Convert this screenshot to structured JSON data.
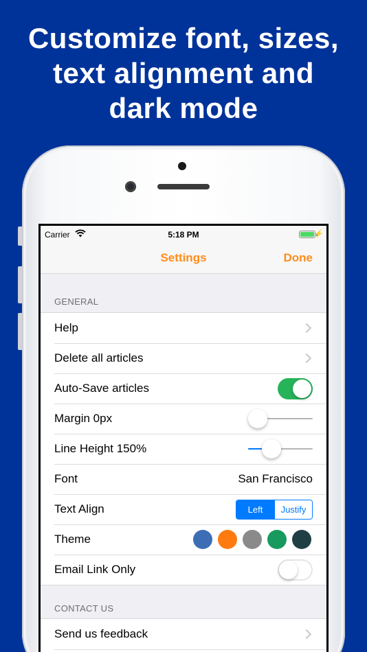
{
  "headline": {
    "line1": "Customize font, sizes,",
    "line2": "text alignment and",
    "line3": "dark mode"
  },
  "status_bar": {
    "carrier": "Carrier",
    "time": "5:18 PM",
    "battery_level": 1.0
  },
  "nav": {
    "title": "Settings",
    "done_label": "Done"
  },
  "general": {
    "header": "GENERAL",
    "help": "Help",
    "delete_all": "Delete all articles",
    "auto_save": {
      "label": "Auto-Save articles",
      "on": true
    },
    "margin": {
      "label": "Margin 0px",
      "value": 0.0
    },
    "line_height": {
      "label": "Line Height 150%",
      "value": 0.3
    },
    "font": {
      "label": "Font",
      "value": "San Francisco"
    },
    "text_align": {
      "label": "Text Align",
      "options": [
        "Left",
        "Justify"
      ],
      "selected": "Left"
    },
    "theme": {
      "label": "Theme",
      "colors": [
        "#3d6db5",
        "#ff7b0f",
        "#8a8a8a",
        "#18995e",
        "#1f3f44"
      ]
    },
    "email_link_only": {
      "label": "Email Link Only",
      "on": false
    }
  },
  "contact": {
    "header": "CONTACT US",
    "feedback": "Send us feedback"
  },
  "colors": {
    "background": "#003399",
    "accent": "#ff8c1a",
    "ios_blue": "#007aff",
    "toggle_on": "#26b35a"
  },
  "icons": [
    "wifi-icon",
    "battery-icon",
    "bolt-icon",
    "chevron-right-icon"
  ]
}
